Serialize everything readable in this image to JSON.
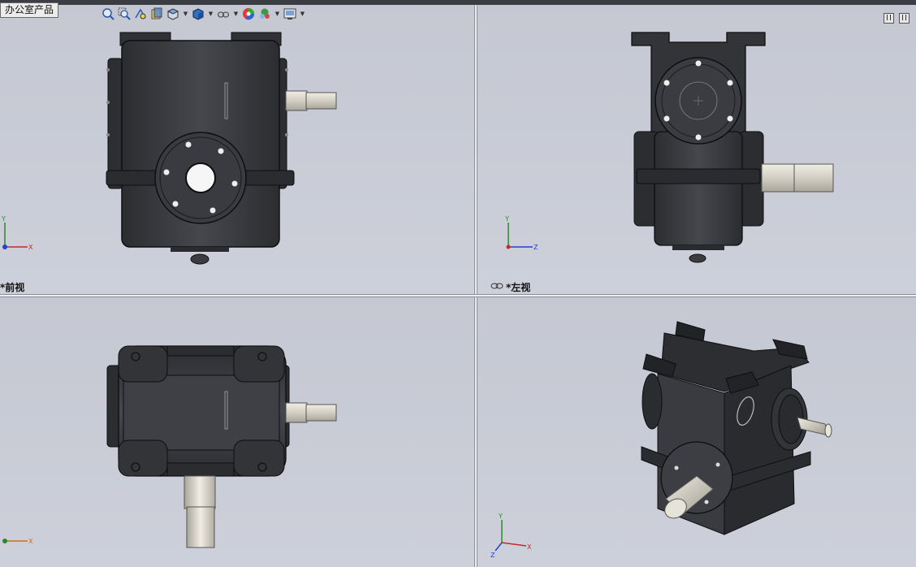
{
  "tooltip": {
    "text": "办公室产品"
  },
  "toolbar": {
    "icons": [
      "zoom-to-fit-icon",
      "zoom-area-icon",
      "previous-view-icon",
      "section-view-icon",
      "view-orientation-icon",
      "display-style-icon",
      "hide-show-icon",
      "edit-appearance-icon",
      "apply-scene-icon",
      "view-settings-icon"
    ]
  },
  "viewports": {
    "front": {
      "label": "*前视",
      "axes": [
        "Y",
        "X"
      ]
    },
    "left": {
      "label": "*左视",
      "axes": [
        "Y",
        "Z"
      ]
    },
    "top": {
      "label": "",
      "axes": [
        "X"
      ]
    },
    "iso": {
      "label": "",
      "axes": [
        "Y",
        "X",
        "Z"
      ]
    }
  },
  "colors": {
    "body": "#3b3c40",
    "body_dark": "#232428",
    "edge": "#121214",
    "shaft": "#d8d5cc",
    "hole": "#f4f4f4",
    "background": "#c9ccd6"
  }
}
